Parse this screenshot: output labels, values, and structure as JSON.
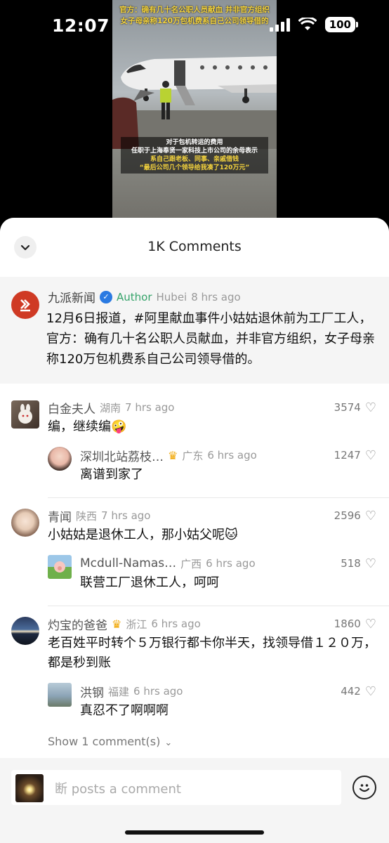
{
  "status_bar": {
    "time": "12:07",
    "battery": "100"
  },
  "video": {
    "headline_1": "官方：确有几十名公职人员献血 并非官方组织",
    "headline_2": "女子母亲称120万包机费系自己公司领导借的",
    "caption": [
      "对于包机转运的费用",
      "任职于上海奉贤一家科技上市公司的余母表示",
      "系自己跟老板、同事、亲戚借钱",
      "“最后公司几个领导给我凑了120万元”"
    ]
  },
  "sheet": {
    "title": "1K Comments",
    "collapse_icon": "chevron-down-icon"
  },
  "author_post": {
    "name": "九派新闻",
    "tag": "Author",
    "location": "Hubei",
    "time": "8 hrs ago",
    "text": "12月6日报道，#阿里献血事件小姑姑退休前为工厂工人，官方：确有几十名公职人员献血，并非官方组织，女子母亲称120万包机费系自己公司领导借的。",
    "avatar_color": "#cf3a24"
  },
  "comments": [
    {
      "name": "白金夫人",
      "location": "湖南",
      "time": "7 hrs ago",
      "likes": "3574",
      "text": "编，继续编🤪",
      "reply": {
        "name": "深圳北站荔枝…",
        "location": "广东",
        "time": "6 hrs ago",
        "likes": "1247",
        "text": "离谱到家了"
      }
    },
    {
      "name": "青闻",
      "location": "陕西",
      "time": "7 hrs ago",
      "likes": "2596",
      "text": "小姑姑是退休工人，那小姑父呢🐱",
      "reply": {
        "name": "Mcdull-Namas…",
        "location": "广西",
        "time": "6 hrs ago",
        "likes": "518",
        "text": "联营工厂退休工人，呵呵"
      }
    },
    {
      "name": "灼宝的爸爸",
      "location": "浙江",
      "time": "6 hrs ago",
      "likes": "1860",
      "text": "老百姓平时转个５万银行都卡你半天，找领导借１２０万，都是秒到账",
      "reply": {
        "name": "洪钢",
        "location": "福建",
        "time": "6 hrs ago",
        "likes": "442",
        "text": "真忍不了啊啊啊"
      }
    }
  ],
  "show_more": "Show 1 comment(s)",
  "input": {
    "placeholder": "断 posts a comment",
    "emoji_icon": "smiley-icon"
  }
}
